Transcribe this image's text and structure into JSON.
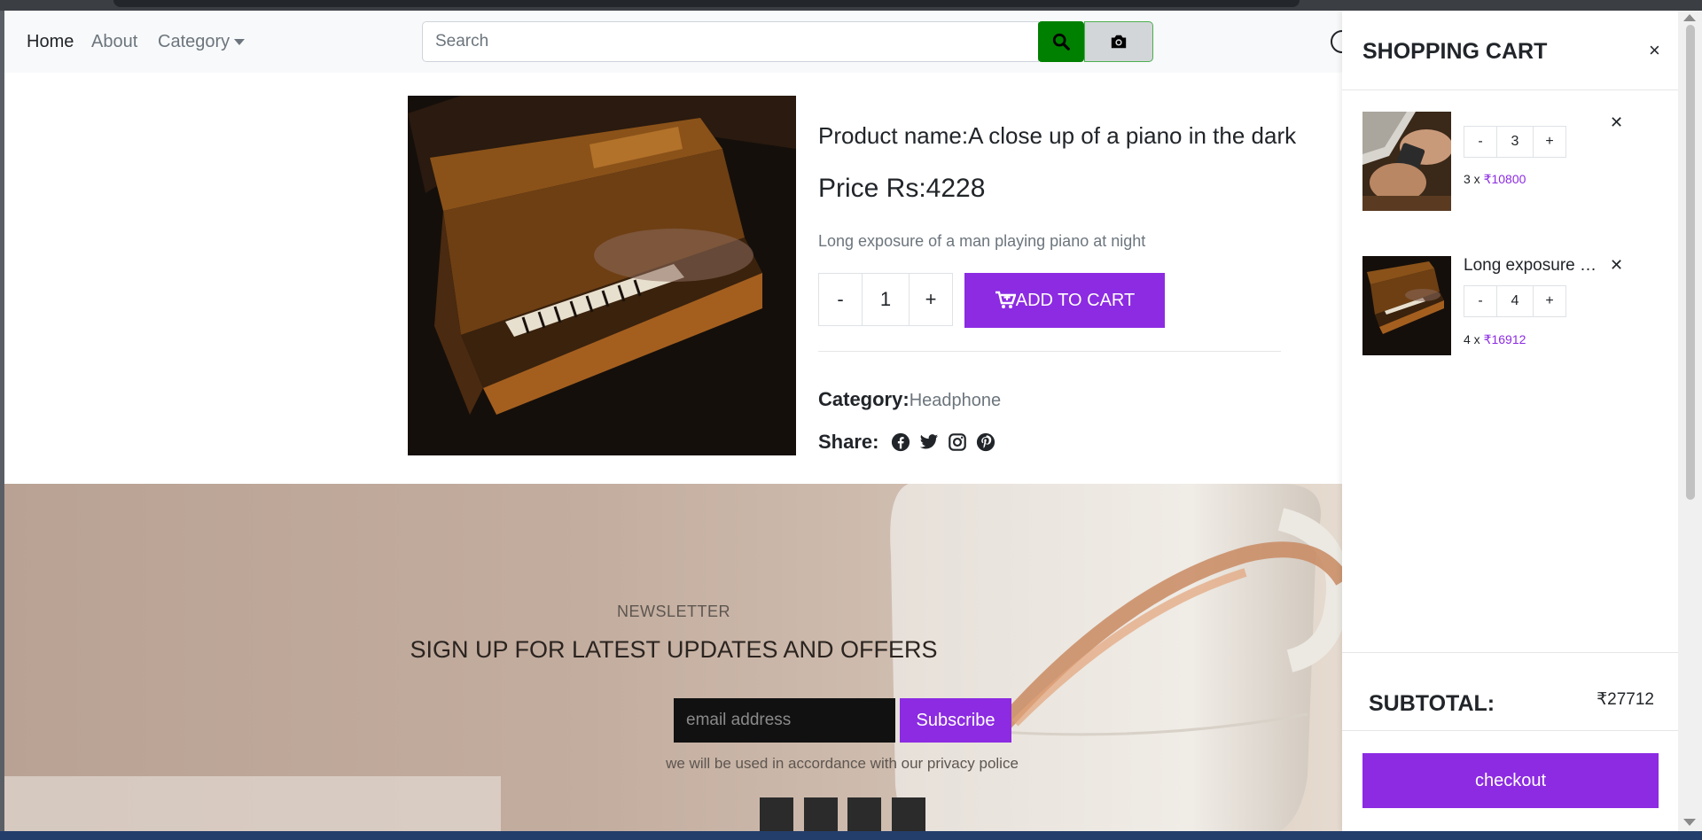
{
  "nav": {
    "home": "Home",
    "about": "About",
    "category": "Category"
  },
  "search": {
    "placeholder": "Search",
    "value": ""
  },
  "product": {
    "name": "Product name:A close up of a piano in the dark",
    "price": "Price Rs:4228",
    "description": "Long exposure of a man playing piano at night",
    "qty_minus": "-",
    "qty_value": "1",
    "qty_plus": "+",
    "add_to_cart": "ADD TO CART",
    "category_label": "Category:",
    "category_value": "Headphone",
    "share_label": "Share:",
    "share_icons": [
      "facebook-icon",
      "twitter-icon",
      "instagram-icon",
      "pinterest-icon"
    ]
  },
  "newsletter": {
    "kicker": "NEWSLETTER",
    "title": "SIGN UP FOR LATEST UPDATES AND OFFERS",
    "email_placeholder": "email address",
    "subscribe": "Subscribe",
    "note": "we will be used in accordance with our privacy police"
  },
  "cart": {
    "title": "SHOPPING CART",
    "close": "×",
    "items": [
      {
        "name": "",
        "remove": "✕",
        "minus": "-",
        "qty": "3",
        "plus": "+",
        "line_qty": "3 x",
        "line_amount": "₹10800"
      },
      {
        "name": "Long exposure of a man playing piano at night",
        "remove": "✕",
        "minus": "-",
        "qty": "4",
        "plus": "+",
        "line_qty": "4 x",
        "line_amount": "₹16912"
      }
    ],
    "subtotal_label": "SUBTOTAL:",
    "subtotal_value": "₹27712",
    "checkout": "checkout"
  },
  "colors": {
    "accent": "#8c2be2",
    "search_button": "#008000"
  }
}
